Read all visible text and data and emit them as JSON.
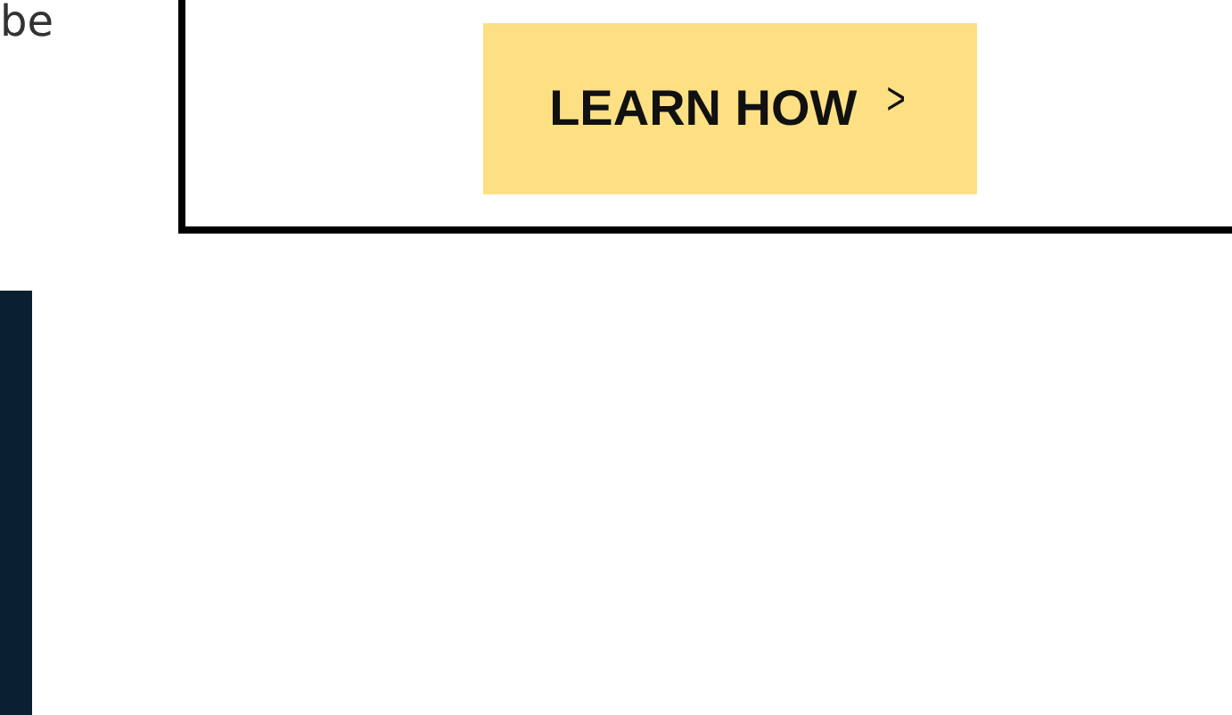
{
  "text_fragment": "be",
  "cta_button": {
    "label": "LEARN HOW",
    "icon": ">"
  }
}
